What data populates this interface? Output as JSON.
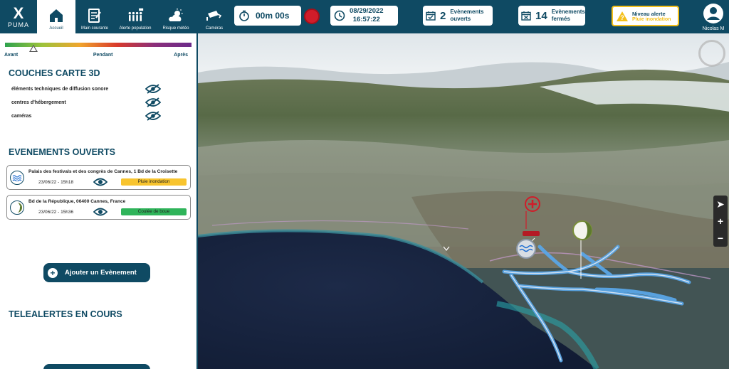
{
  "app": {
    "logo_mark": "X",
    "logo_name": "PUMA"
  },
  "nav": [
    {
      "label": "Accueil",
      "icon": "home-icon",
      "active": true
    },
    {
      "label": "Main courante",
      "icon": "clipboard-icon"
    },
    {
      "label": "Alerte population",
      "icon": "population-icon"
    },
    {
      "label": "Risque météo",
      "icon": "weather-icon"
    },
    {
      "label": "Caméras",
      "icon": "camera-icon"
    }
  ],
  "header": {
    "timer": "00m 00s",
    "date": "08/29/2022",
    "time": "16:57:22",
    "open_events_count": "2",
    "open_events_label1": "Evènements",
    "open_events_label2": "ouverts",
    "closed_events_count": "14",
    "closed_events_label1": "Evènements",
    "closed_events_label2": "fermés",
    "alert_title": "Niveau alerte",
    "alert_value": "Pluie inondation",
    "user_name": "Nicolas M"
  },
  "colors": {
    "primary": "#0f4a63",
    "alert": "#f4c01b",
    "record": "#d01d2a",
    "rain_tag": "#f8c42e",
    "mud_tag": "#2fb45a"
  },
  "timeline": {
    "start": "Avant",
    "middle": "Pendant",
    "end": "Après"
  },
  "layers": {
    "title": "COUCHES CARTE 3D",
    "items": [
      {
        "label": "éléments techniques de diffusion sonore"
      },
      {
        "label": "centres d'hébergement"
      },
      {
        "label": "caméras"
      }
    ]
  },
  "events": {
    "title": "EVENEMENTS OUVERTS",
    "items": [
      {
        "address": "Palais des festivals et des congrès de Cannes, 1 Bd de la Croisette",
        "date": "23/06/22 - 15h18",
        "tag": "Pluie inondation"
      },
      {
        "address": "Bd de la République, 06400 Cannes, France",
        "date": "23/06/22 - 15h36",
        "tag": "Coulée de boue"
      }
    ],
    "add_label": "Ajouter un Evènement"
  },
  "telealerts": {
    "title": "TELEALERTES EN COURS"
  }
}
